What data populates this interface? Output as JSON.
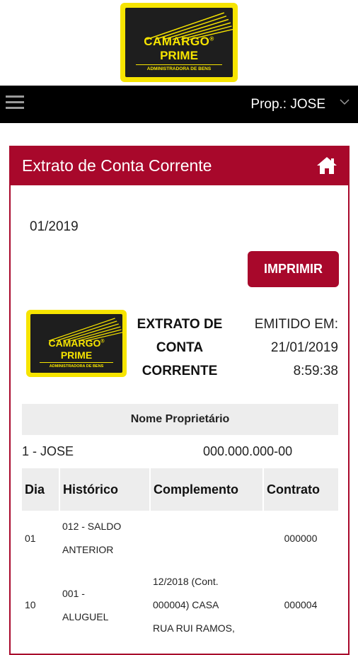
{
  "brand": {
    "name_line1": "CAMARGO",
    "name_line2": "PRIME",
    "registered": "®",
    "tagline": "ADMINISTRADORA DE BENS"
  },
  "navbar": {
    "menu_icon": "hamburger-menu-icon",
    "user_label": "Prop.: JOSE",
    "dropdown_icon": "chevron-down-icon"
  },
  "panel": {
    "title": "Extrato de Conta Corrente",
    "home_icon": "home-icon",
    "period": "01/2019",
    "print_button": "IMPRIMIR",
    "doc_title_lines": [
      "EXTRATO DE",
      "CONTA",
      "CORRENTE"
    ],
    "issued_label": "EMITIDO EM:",
    "issued_date": "21/01/2019",
    "issued_time": "8:59:38"
  },
  "owner": {
    "header": "Nome Proprietário",
    "name": "1 - JOSE",
    "document": "000.000.000-00"
  },
  "table": {
    "columns": [
      "Dia",
      "Histórico",
      "Complemento",
      "Contrato"
    ],
    "rows": [
      {
        "dia": "01",
        "historico_l1": "012 - SALDO",
        "historico_l2": "ANTERIOR",
        "complemento_l1": "",
        "complemento_l2": "",
        "complemento_l3": "",
        "contrato": "000000"
      },
      {
        "dia": "10",
        "historico_l1": "001 -",
        "historico_l2": "ALUGUEL",
        "complemento_l1": "12/2018 (Cont.",
        "complemento_l2": "000004) CASA",
        "complemento_l3": "RUA RUI RAMOS,",
        "contrato": "000004"
      }
    ]
  },
  "colors": {
    "brand_red": "#a8082b",
    "brand_yellow": "#f6e400",
    "nav_black": "#000000",
    "table_header_gray": "#ededed"
  }
}
